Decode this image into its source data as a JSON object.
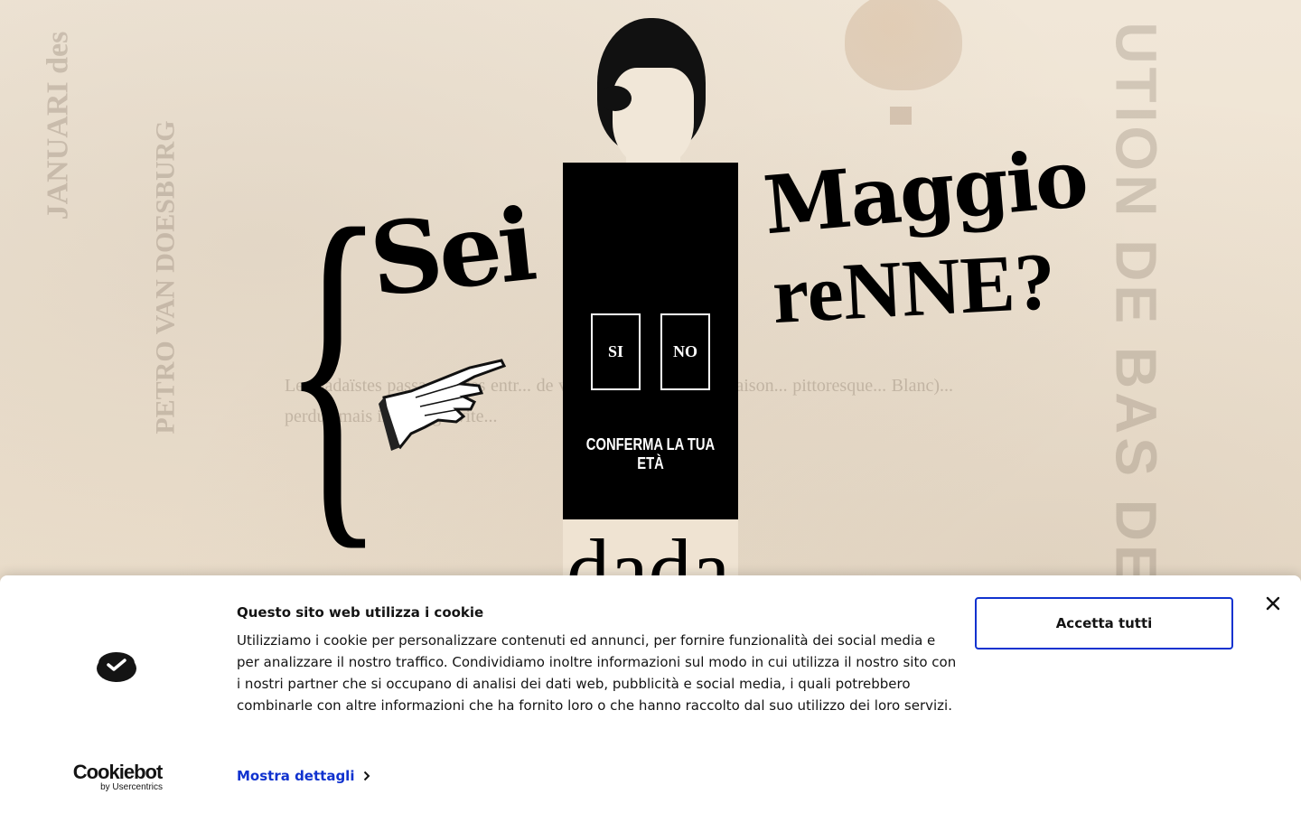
{
  "age_gate": {
    "headline_left": "Sei",
    "headline_right_1": "Maggio",
    "headline_right_2": "reNNE?",
    "yes_label": "SI",
    "no_label": "NO",
    "confirm_text": "CONFERMA LA TUA ETÀ",
    "logo_text": "dada"
  },
  "cookie_banner": {
    "title": "Questo sito web utilizza i cookie",
    "body": "Utilizziamo i cookie per personalizzare contenuti ed annunci, per fornire funzionalità dei social media e per analizzare il nostro traffico. Condividiamo inoltre informazioni sul modo in cui utilizza il nostro sito con i nostri partner che si occupano di analisi dei dati web, pubblicità e social media, i quali potrebbero combinarle con altre informazioni che ha fornito loro o che hanno raccolto dal suo utilizzo dei loro servizi.",
    "details_link": "Mostra dettagli",
    "accept_button": "Accetta tutti",
    "brand_name": "Cookiebot",
    "brand_by": "by Usercentrics",
    "accent_color": "#1032cf"
  }
}
